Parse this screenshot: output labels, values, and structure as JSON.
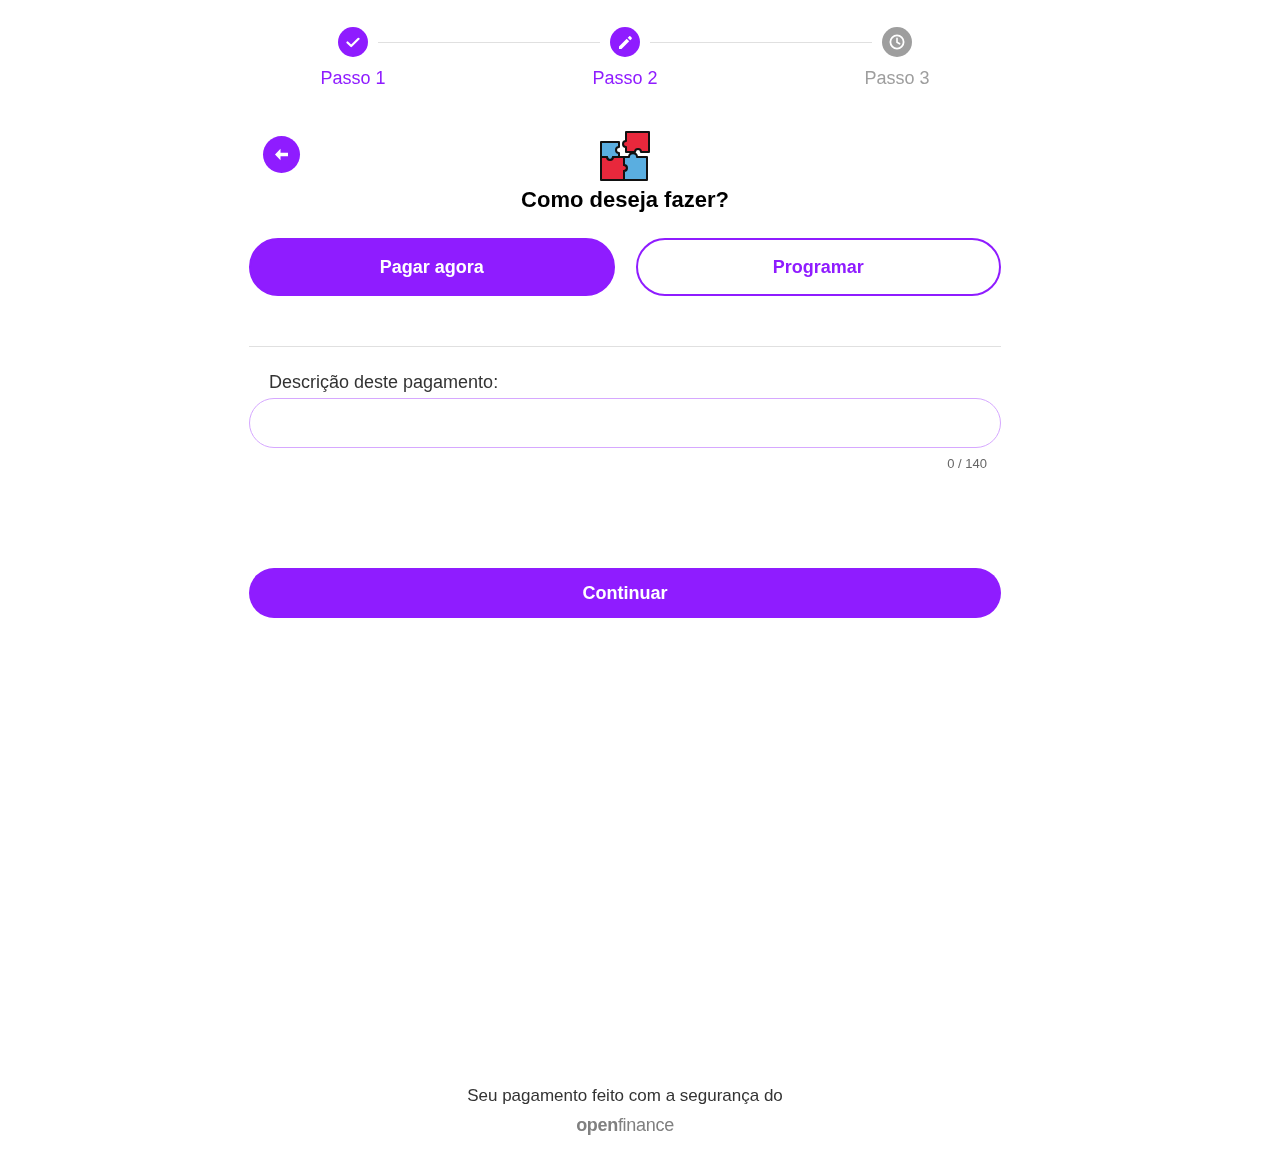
{
  "stepper": {
    "steps": [
      {
        "label": "Passo 1",
        "kind": "done"
      },
      {
        "label": "Passo 2",
        "kind": "current"
      },
      {
        "label": "Passo 3",
        "kind": "pending"
      }
    ]
  },
  "header": {
    "title": "Como deseja fazer?"
  },
  "mode_options": [
    {
      "label": "Pagar agora",
      "selected": true
    },
    {
      "label": "Programar",
      "selected": false
    }
  ],
  "description": {
    "label": "Descrição deste pagamento:",
    "counter": "0 / 140"
  },
  "continue_button": {
    "label": "Continuar"
  },
  "footer": {
    "text": "Seu pagamento feito com a segurança do",
    "logo": "**open**finance"
  }
}
